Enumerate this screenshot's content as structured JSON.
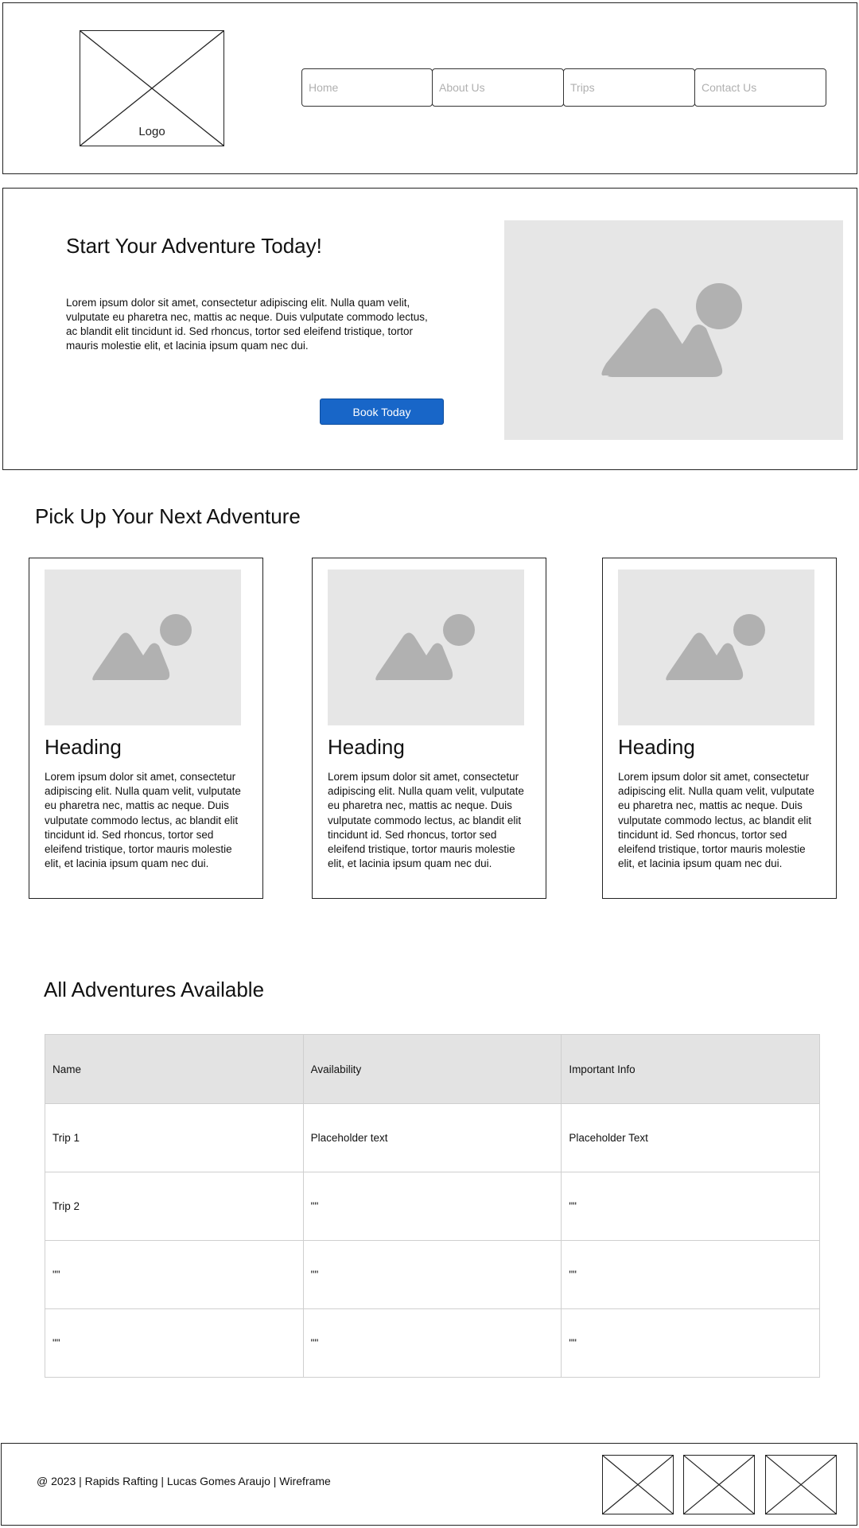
{
  "header": {
    "logo_label": "Logo",
    "nav": [
      "Home",
      "About Us",
      "Trips",
      "Contact Us"
    ]
  },
  "hero": {
    "title": "Start Your Adventure Today!",
    "text": "Lorem ipsum dolor sit amet, consectetur adipiscing elit. Nulla quam velit, vulputate eu pharetra nec, mattis ac neque. Duis vulputate commodo lectus, ac blandit elit tincidunt id. Sed rhoncus, tortor sed eleifend tristique, tortor mauris molestie elit, et lacinia ipsum quam nec dui.",
    "button": "Book Today"
  },
  "cards_section": {
    "title": "Pick Up Your Next Adventure",
    "cards": [
      {
        "heading": "Heading",
        "text": "Lorem ipsum dolor sit amet, consectetur adipiscing elit. Nulla quam velit, vulputate eu pharetra nec, mattis ac neque. Duis vulputate commodo lectus, ac blandit elit tincidunt id. Sed rhoncus, tortor sed eleifend tristique, tortor mauris molestie elit, et lacinia ipsum quam nec dui."
      },
      {
        "heading": "Heading",
        "text": "Lorem ipsum dolor sit amet, consectetur adipiscing elit. Nulla quam velit, vulputate eu pharetra nec, mattis ac neque. Duis vulputate commodo lectus, ac blandit elit tincidunt id. Sed rhoncus, tortor sed eleifend tristique, tortor mauris molestie elit, et lacinia ipsum quam nec dui."
      },
      {
        "heading": "Heading",
        "text": "Lorem ipsum dolor sit amet, consectetur adipiscing elit. Nulla quam velit, vulputate eu pharetra nec, mattis ac neque. Duis vulputate commodo lectus, ac blandit elit tincidunt id. Sed rhoncus, tortor sed eleifend tristique, tortor mauris molestie elit, et lacinia ipsum quam nec dui."
      }
    ]
  },
  "table_section": {
    "title": "All Adventures Available",
    "columns": [
      "Name",
      "Availability",
      "Important Info"
    ],
    "rows": [
      [
        "Trip 1",
        "Placeholder text",
        "Placeholder Text"
      ],
      [
        "Trip 2",
        "\"\"",
        "\"\""
      ],
      [
        "\"\"",
        "\"\"",
        "\"\""
      ],
      [
        "\"\"",
        "\"\"",
        "\"\""
      ]
    ]
  },
  "footer": {
    "text": "@ 2023 | Rapids Rafting | Lucas Gomes Araujo | Wireframe"
  },
  "icons": {
    "image_placeholder": "image-placeholder-icon",
    "social_placeholder": "placeholder-x-icon"
  },
  "colors": {
    "button": "#1866c8",
    "placeholder_bg": "#e6e6e6",
    "placeholder_icon": "#b1b1b1",
    "table_header_bg": "#e3e3e3"
  }
}
